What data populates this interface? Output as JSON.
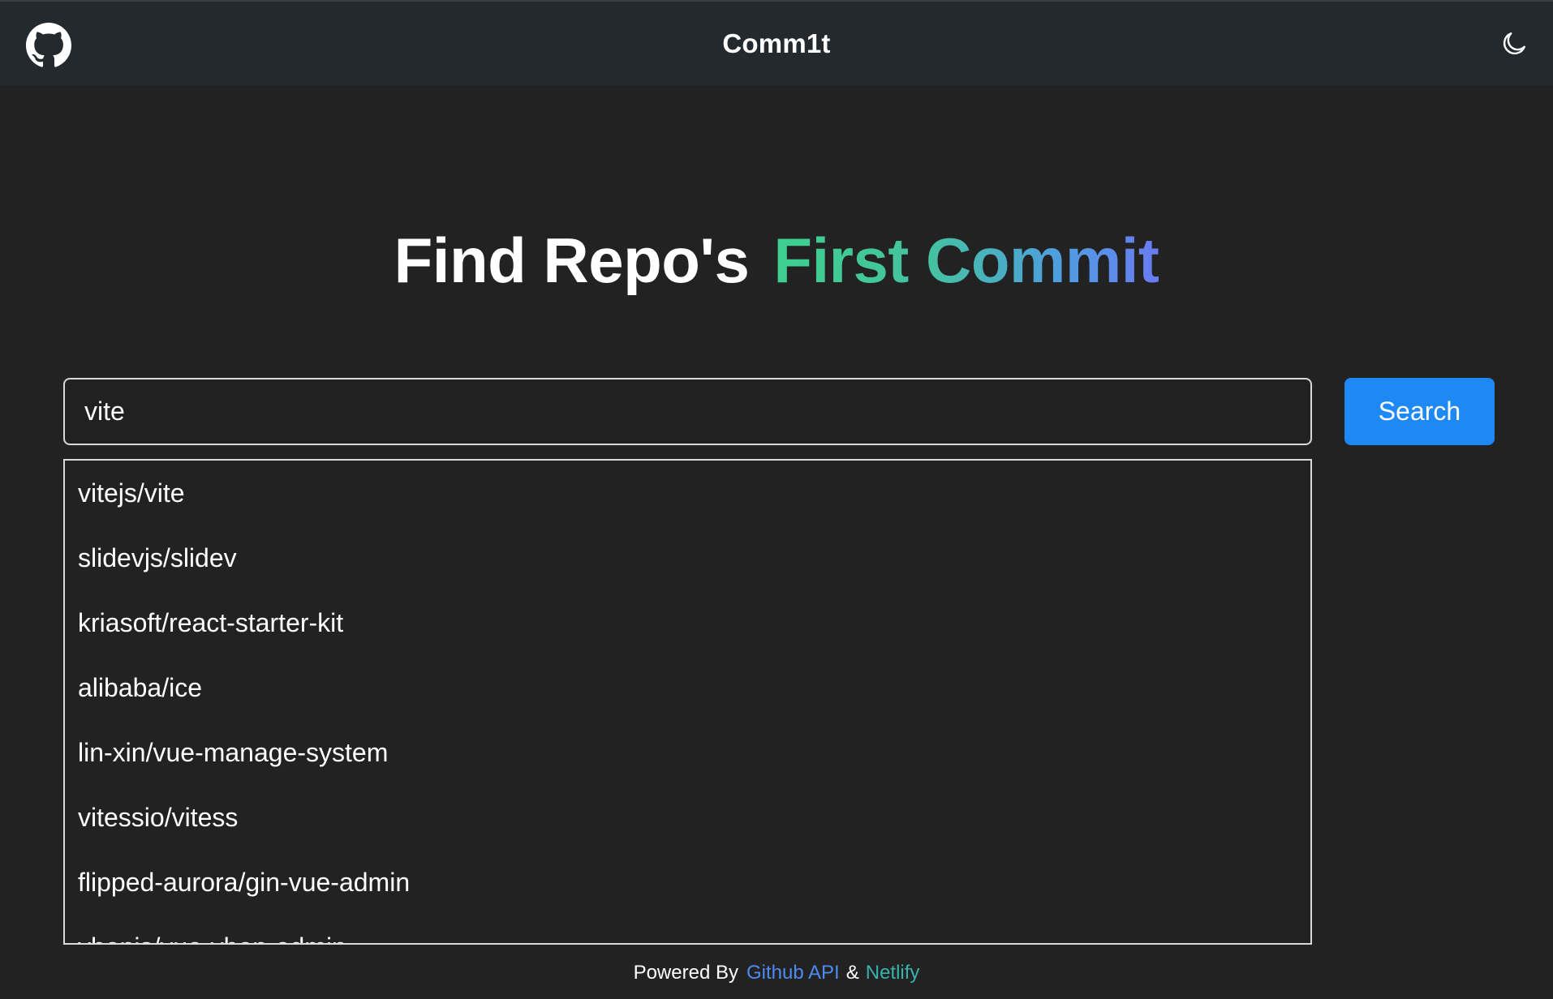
{
  "header": {
    "title": "Comm1t",
    "logo_icon": "github-icon",
    "theme_icon": "moon-icon"
  },
  "hero": {
    "title_plain": "Find Repo's",
    "title_highlight": "First Commit",
    "highlight_gradient": [
      "#3ecf8e",
      "#6a7bf2"
    ]
  },
  "search": {
    "value": "vite",
    "placeholder": "",
    "button_label": "Search",
    "button_color": "#1e88f5"
  },
  "suggestions": [
    "vitejs/vite",
    "slidevjs/slidev",
    "kriasoft/react-starter-kit",
    "alibaba/ice",
    "lin-xin/vue-manage-system",
    "vitessio/vitess",
    "flipped-aurora/gin-vue-admin",
    "vbenjs/vue-vben-admin"
  ],
  "footer": {
    "prefix": "Powered By",
    "link1": "Github API",
    "separator": "&",
    "link2": "Netlify"
  },
  "colors": {
    "background": "#222222",
    "header": "#24292e",
    "link_github": "#4d8bf0",
    "link_netlify": "#38b2ac"
  }
}
